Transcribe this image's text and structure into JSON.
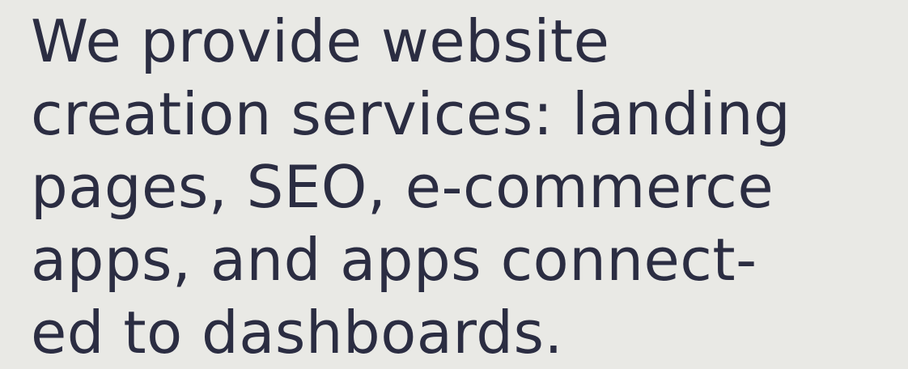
{
  "hero": {
    "lines": [
      "We provide website",
      "creation services: landing",
      "pages, SEO, e-commerce",
      "apps, and apps connect-",
      "ed to dashboards."
    ]
  },
  "colors": {
    "background": "#e9e9e5",
    "text": "#2b2d42"
  }
}
